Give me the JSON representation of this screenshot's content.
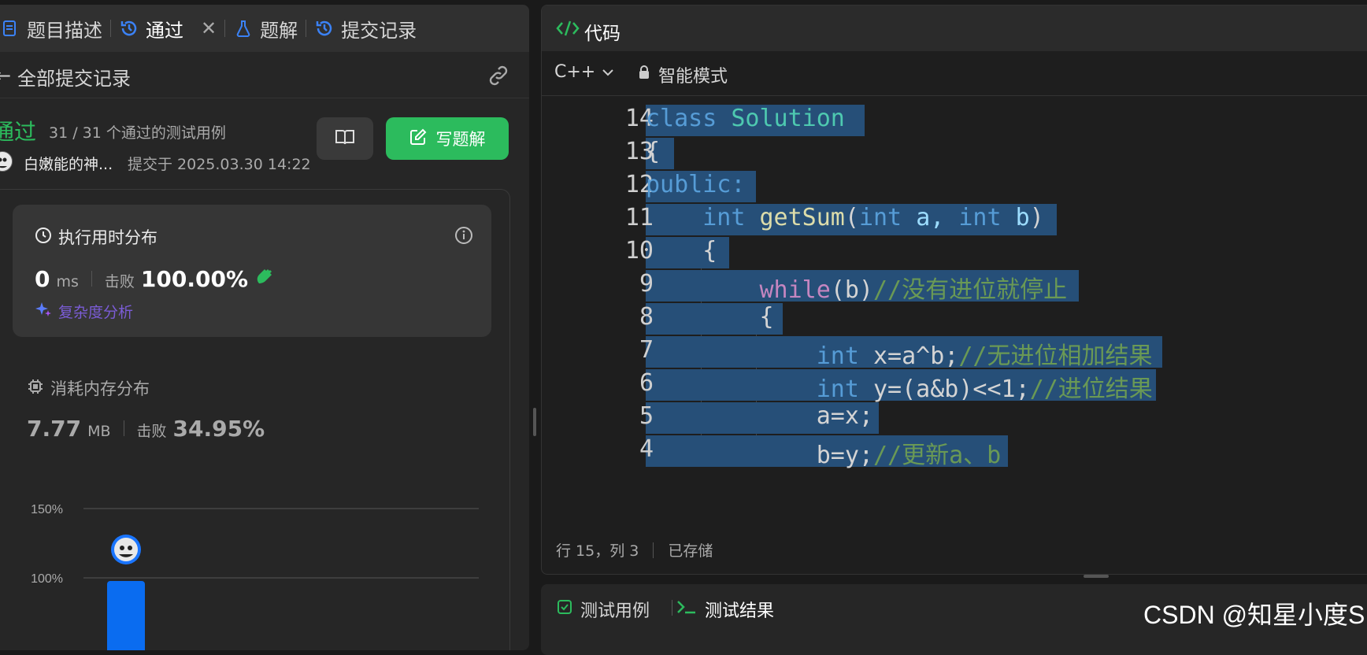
{
  "left": {
    "tabs": [
      {
        "label": "题目描述"
      },
      {
        "label": "通过"
      },
      {
        "label": "题解"
      },
      {
        "label": "提交记录"
      }
    ],
    "sub_header": {
      "title": "全部提交记录"
    },
    "submission": {
      "status": "通过",
      "tests": "31 / 31 个通过的测试用例",
      "user": "白嫩能的神...",
      "submitted": "提交于 2025.03.30 14:22",
      "write_solution_label": "写题解"
    },
    "runtime_card": {
      "title": "执行用时分布",
      "value": "0",
      "unit": "ms",
      "beat_label": "击败",
      "beat_pct": "100.00%",
      "complexity_label": "复杂度分析"
    },
    "memory": {
      "title": "消耗内存分布",
      "value": "7.77",
      "unit": "MB",
      "beat_label": "击败",
      "beat_pct": "34.95%"
    },
    "chart_ticks": {
      "t150": "150%",
      "t100": "100%"
    }
  },
  "right": {
    "title": "代码",
    "language": "C++",
    "mode": "智能模式",
    "lines": [
      {
        "n": "14"
      },
      {
        "n": "13"
      },
      {
        "n": "12"
      },
      {
        "n": "11"
      },
      {
        "n": "10"
      },
      {
        "n": "9"
      },
      {
        "n": "8"
      },
      {
        "n": "7"
      },
      {
        "n": "6"
      },
      {
        "n": "5"
      },
      {
        "n": "4"
      }
    ],
    "code": {
      "l14_a": "class",
      "l14_b": "Solution",
      "l13": "{",
      "l12": "public:",
      "l11_int1": "int",
      "l11_fn": "getSum",
      "l11_p1": "(",
      "l11_int2": "int",
      "l11_a": "a,",
      "l11_int3": "int",
      "l11_b": "b",
      "l11_p2": ")",
      "l10": "{",
      "l9_kw": "while",
      "l9_cond": "(b)",
      "l9_cm": "//没有进位就停止",
      "l8": "{",
      "l7_int": "int",
      "l7_expr": "x=a^b;",
      "l7_cm": "//无进位相加结果",
      "l6_int": "int",
      "l6_expr": "y=(a&b)<<1;",
      "l6_cm": "//进位结果",
      "l5": "a=x;",
      "l4_expr": "b=y;",
      "l4_cm": "//更新a、b"
    },
    "status": {
      "pos": "行 15，列 3",
      "saved": "已存储"
    }
  },
  "bottom": {
    "tab1": "测试用例",
    "tab2": "测试结果"
  },
  "watermark": "CSDN @知星小度S",
  "colors": {
    "accent_green": "#2cbb5d",
    "selection": "#264f78",
    "editor_bg": "#1e1e1e"
  }
}
